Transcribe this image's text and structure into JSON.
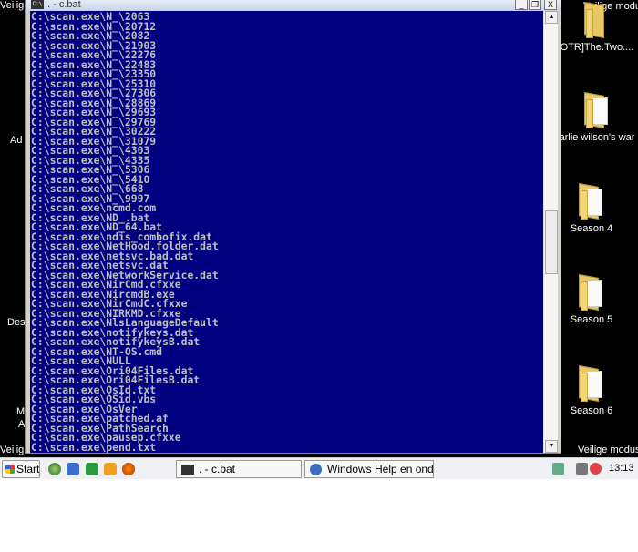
{
  "desktop": {
    "left_labels": [
      "Veilig",
      "Ad",
      "Des",
      "M",
      "A",
      "Veilig"
    ],
    "top_right_label": "Veilige modus",
    "bottom_right_label": "Veilige modus",
    "icons": [
      {
        "label": "OTR]The.Two...."
      },
      {
        "label": "arlie wilson's war"
      },
      {
        "label": "Season 4"
      },
      {
        "label": "Season 5"
      },
      {
        "label": "Season 6"
      }
    ]
  },
  "window": {
    "icon_text": "C:\\",
    "title": ". - c.bat",
    "minimize": "_",
    "restore": "❐",
    "close": "X",
    "scroll_up": "▲",
    "scroll_down": "▼",
    "lines": [
      "C:\\scan.exe\\N_\\2063",
      "C:\\scan.exe\\N_\\20712",
      "C:\\scan.exe\\N_\\2082",
      "C:\\scan.exe\\N_\\21903",
      "C:\\scan.exe\\N_\\22276",
      "C:\\scan.exe\\N_\\22483",
      "C:\\scan.exe\\N_\\23350",
      "C:\\scan.exe\\N_\\25310",
      "C:\\scan.exe\\N_\\27306",
      "C:\\scan.exe\\N_\\28869",
      "C:\\scan.exe\\N_\\29693",
      "C:\\scan.exe\\N_\\29769",
      "C:\\scan.exe\\N_\\30222",
      "C:\\scan.exe\\N_\\31079",
      "C:\\scan.exe\\N_\\4303",
      "C:\\scan.exe\\N_\\4335",
      "C:\\scan.exe\\N_\\5306",
      "C:\\scan.exe\\N_\\5410",
      "C:\\scan.exe\\N_\\668",
      "C:\\scan.exe\\N_\\9997",
      "C:\\scan.exe\\ncmd.com",
      "C:\\scan.exe\\ND_.bat",
      "C:\\scan.exe\\ND_64.bat",
      "C:\\scan.exe\\ndis_combofix.dat",
      "C:\\scan.exe\\NetHood.folder.dat",
      "C:\\scan.exe\\netsvc.bad.dat",
      "C:\\scan.exe\\netsvc.dat",
      "C:\\scan.exe\\NetworkService.dat",
      "C:\\scan.exe\\NirCmd.cfxxe",
      "C:\\scan.exe\\NircmdB.exe",
      "C:\\scan.exe\\NirCmdC.cfxxe",
      "C:\\scan.exe\\NIRKMD.cfxxe",
      "C:\\scan.exe\\NlsLanguageDefault",
      "C:\\scan.exe\\notifykeys.dat",
      "C:\\scan.exe\\notifykeysB.dat",
      "C:\\scan.exe\\NT-OS.cmd",
      "C:\\scan.exe\\NULL",
      "C:\\scan.exe\\Ori04Files.dat",
      "C:\\scan.exe\\Ori04FilesB.dat",
      "C:\\scan.exe\\OsId.txt",
      "C:\\scan.exe\\OSid.vbs",
      "C:\\scan.exe\\OsVer",
      "C:\\scan.exe\\patched.af",
      "C:\\scan.exe\\PathSearch",
      "C:\\scan.exe\\pausep.cfxxe",
      "C:\\scan.exe\\pend.txt"
    ]
  },
  "taskbar": {
    "start_label": "Start",
    "tasks": [
      {
        "label": ". - c.bat"
      },
      {
        "label": "Windows Help en onde..."
      }
    ],
    "clock": "13:13"
  },
  "colors": {
    "console_bg": "#000080",
    "console_fg": "#c0c0c0"
  }
}
